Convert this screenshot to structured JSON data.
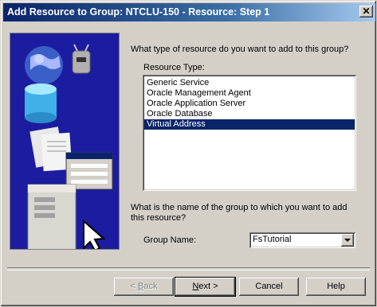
{
  "window": {
    "title": "Add Resource to Group: NTCLU-150 - Resource:  Step 1",
    "close_glyph": "✕"
  },
  "form": {
    "question1": "What type of resource do you want to add to this group?",
    "resource_type_label": "Resource Type:",
    "resource_types": [
      "Generic Service",
      "Oracle Management Agent",
      "Oracle Application Server",
      "Oracle Database",
      "Virtual Address"
    ],
    "selected_resource_type": "Virtual Address",
    "question2": "What is the name of the group to which you want to add this resource?",
    "group_name_label": "Group Name:",
    "group_name_value": "FsTutorial"
  },
  "buttons": {
    "back": {
      "mnemonic": "B",
      "rest": "ack",
      "prefix": "< "
    },
    "next": {
      "mnemonic": "N",
      "rest": "ext >"
    },
    "cancel": "Cancel",
    "help": "Help"
  },
  "illustration": {
    "icon": "wizard-network-illustration"
  }
}
